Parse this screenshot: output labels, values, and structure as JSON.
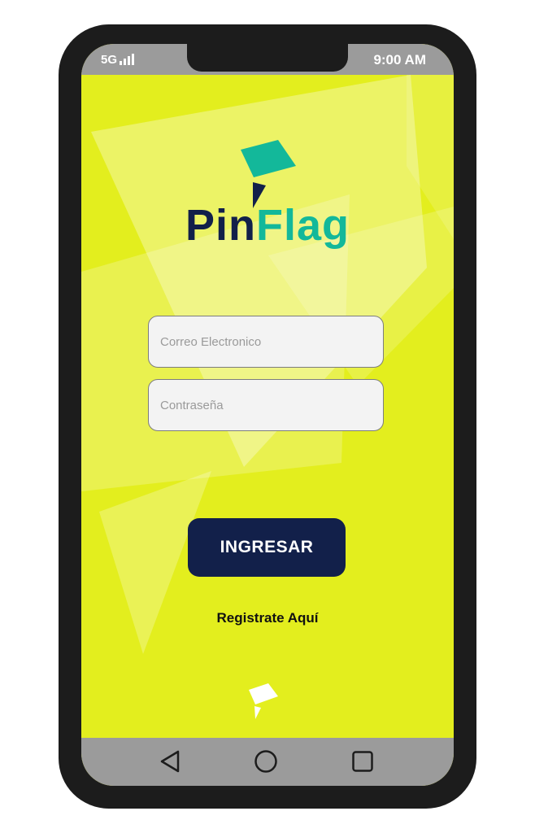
{
  "status_bar": {
    "network": "5G",
    "time": "9:00 AM"
  },
  "brand": {
    "part1": "Pin",
    "part2": "Flag"
  },
  "login_form": {
    "email_placeholder": "Correo Electronico",
    "password_placeholder": "Contraseña",
    "submit_label": "INGRESAR",
    "register_link": "Registrate Aquí"
  },
  "navigation_bar": {
    "back_icon": "triangle-back-icon",
    "home_icon": "circle-home-icon",
    "recents_icon": "square-recents-icon"
  },
  "colors": {
    "background": "#e3ee1e",
    "navy": "#12204a",
    "teal": "#13b89a",
    "phone_frame": "#1c1c1c",
    "system_bars": "#9b9b9b"
  }
}
